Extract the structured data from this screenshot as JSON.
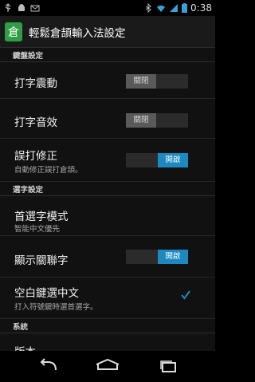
{
  "status_bar": {
    "time": "0:38",
    "icons": [
      "usb-icon",
      "android-icon",
      "mail-icon",
      "bluetooth-icon",
      "wifi-icon",
      "signal-icon",
      "battery-icon"
    ]
  },
  "action_bar": {
    "app_icon_char": "倉",
    "title": "輕鬆倉頡輸入法設定"
  },
  "categories": {
    "keyboard": "鍵盤設定",
    "selection": "選字設定",
    "system": "系統"
  },
  "prefs": {
    "vibrate": {
      "title": "打字震動",
      "toggle": "關閉",
      "on": false
    },
    "sound": {
      "title": "打字音效",
      "toggle": "關閉",
      "on": false
    },
    "autocorrect": {
      "title": "誤打修正",
      "summary": "自動修正誤打倉頡。",
      "toggle": "開啟",
      "on": true
    },
    "first_mode": {
      "title": "首選字模式",
      "summary": "智能中文優先"
    },
    "related": {
      "title": "顯示關聯字",
      "toggle": "開啟",
      "on": true
    },
    "space_select": {
      "title": "空白鍵選中文",
      "summary": "打入符號鍵時選首選字。",
      "checked": true
    },
    "version": {
      "title": "版本"
    }
  },
  "accent_color": "#1c8ac1",
  "app_color": "#2f9e44"
}
